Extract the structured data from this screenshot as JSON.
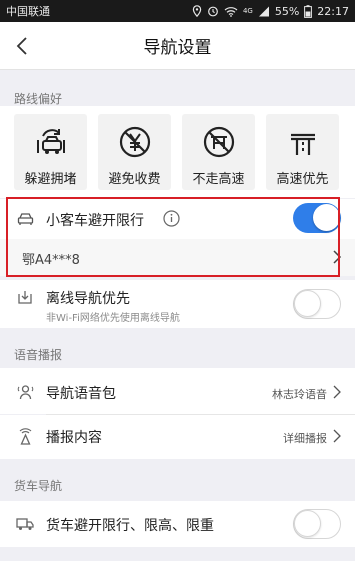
{
  "status_bar": {
    "carrier": "中国联通",
    "signal_label": "4G",
    "battery": "55%",
    "time": "22:17"
  },
  "nav": {
    "title": "导航设置"
  },
  "route_pref": {
    "section_label": "路线偏好",
    "options": [
      {
        "label": "躲避拥堵",
        "icon": "avoid-congestion-icon"
      },
      {
        "label": "避免收费",
        "icon": "no-toll-icon"
      },
      {
        "label": "不走高速",
        "icon": "no-highway-icon"
      },
      {
        "label": "高速优先",
        "icon": "highway-first-icon"
      }
    ]
  },
  "car_restriction": {
    "label": "小客车避开限行",
    "enabled": true,
    "plate": "鄂A4***8"
  },
  "offline_nav": {
    "label": "离线导航优先",
    "sublabel": "非Wi-Fi网络优先使用离线导航",
    "enabled": false
  },
  "voice": {
    "section_label": "语音播报",
    "voice_pack_label": "导航语音包",
    "voice_pack_value": "林志玲语音",
    "broadcast_label": "播报内容",
    "broadcast_value": "详细播报"
  },
  "truck": {
    "section_label": "货车导航",
    "label": "货车避开限行、限高、限重",
    "enabled": false
  },
  "colors": {
    "accent": "#2f7ee9",
    "highlight": "#d81f26"
  }
}
